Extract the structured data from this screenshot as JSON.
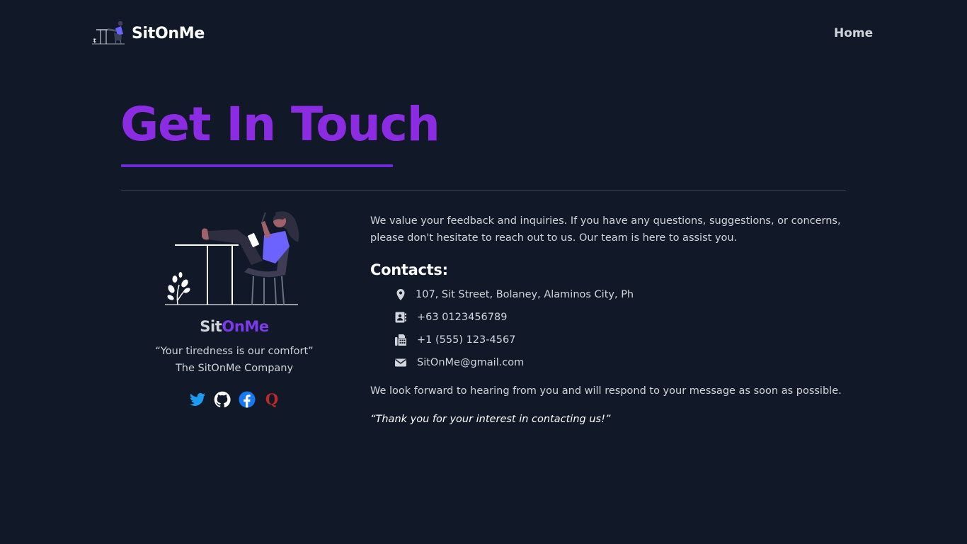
{
  "nav": {
    "brand": "SitOnMe",
    "home_link": "Home"
  },
  "hero": {
    "title": "Get In Touch"
  },
  "profile": {
    "name_part1": "Sit",
    "name_part2": "OnMe",
    "quote": "“Your tiredness is our comfort”",
    "company": "The SitOnMe Company",
    "socials": [
      "twitter-icon",
      "github-icon",
      "facebook-icon",
      "quora-icon"
    ]
  },
  "contact": {
    "intro": "We value your feedback and inquiries. If you have any questions, suggestions, or concerns, please don't hesitate to reach out to us. Our team is here to assist you.",
    "heading": "Contacts:",
    "items": [
      {
        "icon": "location-pin-icon",
        "text": "107, Sit Street, Bolaney, Alaminos City, Ph"
      },
      {
        "icon": "contact-book-icon",
        "text": "+63 0123456789"
      },
      {
        "icon": "fax-icon",
        "text": "+1 (555) 123-4567"
      },
      {
        "icon": "envelope-icon",
        "text": "SitOnMe@gmail.com"
      }
    ],
    "closing": "We look forward to hearing from you and will respond to your message as soon as possible.",
    "thanks": "“Thank you for your interest in contacting us!”"
  },
  "colors": {
    "background": "#111827",
    "accent": "#7c3aed",
    "title_purple": "#8b2be2",
    "text": "#d1d5db",
    "twitter": "#1d9bf0",
    "facebook": "#1877f2",
    "quora": "#b92b27"
  }
}
